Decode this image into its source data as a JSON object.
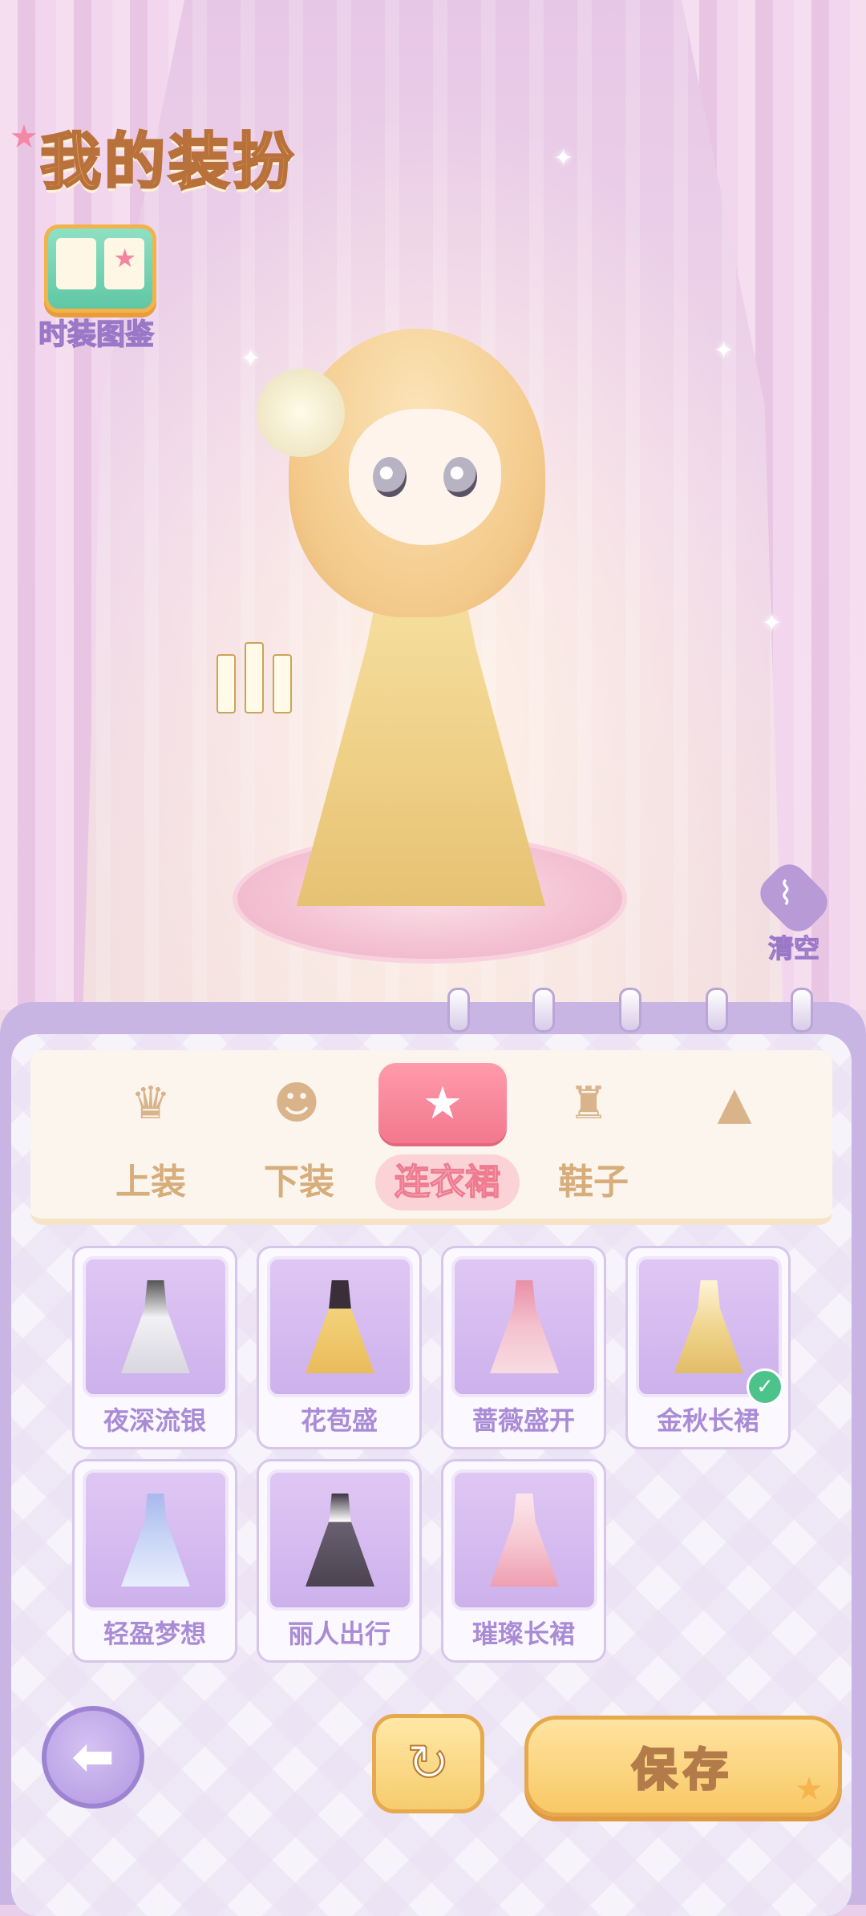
{
  "header": {
    "title": "我的装扮",
    "catalog_label": "时装图鉴"
  },
  "actions": {
    "clear_label": "清空",
    "save_label": "保存"
  },
  "tabs": {
    "icons": [
      "hair-icon",
      "face-icon",
      "outfit-icon",
      "bag-icon",
      "dress-accessory-icon"
    ],
    "labels": [
      "上装",
      "下装",
      "连衣裙",
      "鞋子"
    ],
    "active_index": 2
  },
  "items": [
    {
      "name": "夜深流银",
      "icon": "silver-dress-icon",
      "equipped": false,
      "color": "#f2f1f5"
    },
    {
      "name": "花苞盛",
      "icon": "bud-dress-icon",
      "equipped": false,
      "color": "#f3d27a"
    },
    {
      "name": "蔷薇盛开",
      "icon": "rose-dress-icon",
      "equipped": false,
      "color": "#f4c2cf"
    },
    {
      "name": "金秋长裙",
      "icon": "golden-gown-icon",
      "equipped": true,
      "color": "#f0d58f"
    },
    {
      "name": "轻盈梦想",
      "icon": "light-dream-dress-icon",
      "equipped": false,
      "color": "#c9d6f6"
    },
    {
      "name": "丽人出行",
      "icon": "travel-dress-icon",
      "equipped": false,
      "color": "#6a6170"
    },
    {
      "name": "璀璨长裙",
      "icon": "dazzling-gown-icon",
      "equipped": false,
      "color": "#f6c9d3"
    }
  ],
  "theme": {
    "accent": "#f2788e",
    "panel": "#c9b5e3",
    "label": "#a98bd6",
    "gold": "#f8c966"
  }
}
